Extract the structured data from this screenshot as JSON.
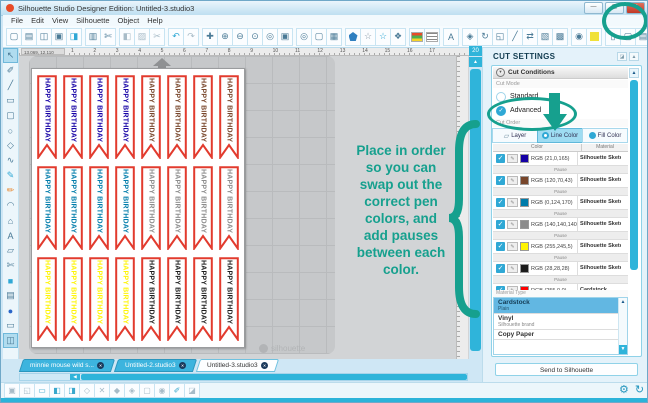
{
  "window": {
    "title": "Silhouette Studio Designer Edition: Untitled-3.studio3",
    "controls": [
      {
        "name": "minimize-button",
        "glyph": "—"
      },
      {
        "name": "maximize-button",
        "glyph": "▢"
      },
      {
        "name": "close-button",
        "glyph": "✕"
      }
    ]
  },
  "menu": [
    "File",
    "Edit",
    "View",
    "Silhouette",
    "Object",
    "Help"
  ],
  "toolbar": {
    "groups": [
      [
        {
          "n": "new-document-icon",
          "g": "▢"
        },
        {
          "n": "open-icon",
          "g": "▤"
        },
        {
          "n": "library-icon",
          "g": "◫"
        },
        {
          "n": "save-icon",
          "g": "▣"
        },
        {
          "n": "save-to-library-icon",
          "g": "◨",
          "c": "#2fa8d5"
        }
      ],
      [
        {
          "n": "print-icon",
          "g": "▥"
        },
        {
          "n": "cutter-icon",
          "g": "✄"
        }
      ],
      [
        {
          "n": "copy-icon",
          "g": "◧",
          "c": "#a8bcc8"
        },
        {
          "n": "paste-icon",
          "g": "▨",
          "c": "#a8bcc8"
        },
        {
          "n": "cut-icon",
          "g": "✂",
          "c": "#a8bcc8"
        }
      ],
      [
        {
          "n": "undo-icon",
          "g": "↶",
          "c": "#2fa8d5"
        },
        {
          "n": "redo-icon",
          "g": "↷",
          "c": "#a8bcc8"
        }
      ],
      [
        {
          "n": "pan-icon",
          "g": "✚"
        },
        {
          "n": "zoom-in-icon",
          "g": "⊕"
        },
        {
          "n": "zoom-out-icon",
          "g": "⊖"
        },
        {
          "n": "zoom-select-icon",
          "g": "⊙"
        },
        {
          "n": "drag-zoom-icon",
          "g": "◎"
        },
        {
          "n": "fit-to-window-icon",
          "g": "▣"
        }
      ],
      [
        {
          "n": "preview-icon",
          "g": "◎"
        },
        {
          "n": "page-settings-icon",
          "g": "▢"
        },
        {
          "n": "grid-settings-icon",
          "g": "▦"
        }
      ],
      [
        {
          "n": "draw-pentagon-icon",
          "shape": "pent"
        },
        {
          "n": "star-tool-icon",
          "g": "☆",
          "c": "#8a9aa8"
        },
        {
          "n": "polygon-tool-icon",
          "g": "☆",
          "c": "#2fa8d5"
        },
        {
          "n": "shape-tool-icon",
          "g": "❖"
        }
      ],
      [
        {
          "n": "fill-color-icon",
          "shape": "colorbars"
        },
        {
          "n": "line-style-icon",
          "shape": "linebars"
        }
      ],
      [
        {
          "n": "text-tool-icon",
          "g": "A"
        }
      ],
      [
        {
          "n": "move-icon",
          "g": "◈"
        },
        {
          "n": "rotate-icon",
          "g": "↻"
        },
        {
          "n": "scale-icon",
          "g": "◱"
        },
        {
          "n": "shear-icon",
          "g": "╱"
        },
        {
          "n": "mirror-icon",
          "g": "⇄"
        },
        {
          "n": "arrange-icon",
          "g": "▧"
        },
        {
          "n": "modify-icon",
          "g": "▩"
        }
      ],
      [
        {
          "n": "stamp-icon",
          "g": "◉"
        },
        {
          "n": "registration-marks-icon",
          "shape": "yellowbox"
        }
      ],
      [
        {
          "n": "pixscan-icon",
          "g": "▯"
        },
        {
          "n": "page-icon",
          "g": "▢"
        },
        {
          "n": "list-icon",
          "g": "▤"
        }
      ],
      [
        {
          "n": "cut-settings-icon",
          "g": "✏",
          "a": true,
          "c": "#1b6a96"
        },
        {
          "n": "blade-settings-icon",
          "g": "✒"
        }
      ]
    ]
  },
  "left_palette": [
    {
      "n": "select-tool",
      "g": "↖",
      "a": true
    },
    {
      "n": "point-edit-tool",
      "g": "✐"
    },
    {
      "n": "line-tool",
      "g": "╱"
    },
    {
      "n": "rectangle-tool",
      "g": "▭"
    },
    {
      "n": "rounded-rectangle-tool",
      "g": "▢"
    },
    {
      "n": "ellipse-tool",
      "g": "○"
    },
    {
      "n": "polygon-tool",
      "g": "◇"
    },
    {
      "n": "curve-tool",
      "g": "∿"
    },
    {
      "n": "freehand-tool",
      "g": "✎",
      "c": "#2fa8d5"
    },
    {
      "n": "smooth-freehand-tool",
      "g": "✏",
      "c": "#e8862a"
    },
    {
      "n": "arc-tool",
      "g": "◠"
    },
    {
      "n": "regular-polygon-tool",
      "g": "⌂"
    },
    {
      "n": "text-tool",
      "g": "A"
    },
    {
      "n": "eraser-tool",
      "g": "▱"
    },
    {
      "n": "knife-tool",
      "g": "✄"
    },
    {
      "n": "fill-tool",
      "g": "■",
      "c": "#2fa8d5"
    },
    {
      "n": "sketch-tool",
      "g": "▤"
    },
    {
      "n": "library-globe",
      "g": "●",
      "c": "#2a66c8"
    },
    {
      "n": "split-horizontal",
      "g": "▭"
    },
    {
      "n": "split-vertical",
      "g": "◫",
      "a": true
    }
  ],
  "ruler": {
    "numbers": [
      "1",
      "2",
      "3",
      "4",
      "5",
      "6",
      "7",
      "8",
      "9",
      "10",
      "11",
      "12",
      "13",
      "14",
      "15",
      "16",
      "17"
    ],
    "end_number": "20",
    "position_readout": "13.069, 12.110"
  },
  "canvas": {
    "banner_text": "HAPPY BIRTHDAY",
    "banner_outline": "#E23B2E",
    "rows": [
      {
        "left": "#1500A5",
        "right": "#78462B"
      },
      {
        "left": "#007CAA",
        "right": "#8C8C8C"
      },
      {
        "left": "#FFF505",
        "right": "#1C1C1C"
      }
    ],
    "watermark": "silhouette"
  },
  "annotation": {
    "text": "Place in order\nso you can\nswap out the\ncorrect pen\ncolors, and\nadd pauses\nbetween each\ncolor.",
    "color": "#16A08E"
  },
  "panel": {
    "title": "CUT SETTINGS",
    "cut_conditions_label": "Cut Conditions",
    "cut_mode_label": "Cut Mode",
    "cut_order_label": "Cut Order",
    "radios": [
      {
        "label": "Standard",
        "selected": false
      },
      {
        "label": "Advanced",
        "selected": true
      }
    ],
    "tabs": [
      {
        "label": "Layer",
        "icon": "layer",
        "active": false
      },
      {
        "label": "Line Color",
        "icon": "ring",
        "active": true
      },
      {
        "label": "Fill Color",
        "icon": "dot",
        "active": false
      }
    ],
    "table": {
      "headers": [
        "Color",
        "Material"
      ],
      "rows": [
        {
          "type": "color",
          "rgb": "RGB (21,0,165)",
          "hex": "#1500A5",
          "material": "Silhouette Sketch Pen",
          "checked": true
        },
        {
          "type": "pause",
          "label": "Pause"
        },
        {
          "type": "color",
          "rgb": "RGB (120,70,43)",
          "hex": "#78462B",
          "material": "Silhouette Sketch Pen",
          "checked": true
        },
        {
          "type": "pause",
          "label": "Pause"
        },
        {
          "type": "color",
          "rgb": "RGB (0,124,170)",
          "hex": "#007CAA",
          "material": "Silhouette Sketch Pen",
          "checked": true
        },
        {
          "type": "pause",
          "label": "Pause"
        },
        {
          "type": "color",
          "rgb": "RGB (140,140,140)",
          "hex": "#8C8C8C",
          "material": "Silhouette Sketch Pen",
          "checked": true
        },
        {
          "type": "pause",
          "label": "Pause"
        },
        {
          "type": "color",
          "rgb": "RGB (255,245,5)",
          "hex": "#FFF505",
          "material": "Silhouette Sketch Pen",
          "checked": true
        },
        {
          "type": "pause",
          "label": "Pause"
        },
        {
          "type": "color",
          "rgb": "RGB (28,28,28)",
          "hex": "#1C1C1C",
          "material": "Silhouette Sketch Pen",
          "checked": true
        },
        {
          "type": "pause",
          "label": "Pause"
        },
        {
          "type": "color",
          "rgb": "RGB (255,0,0)",
          "hex": "#FF0000",
          "material": "Cardstock",
          "checked": true
        }
      ]
    },
    "material_type": {
      "label": "Material Type",
      "options": [
        {
          "name": "Cardstock",
          "sub": "Plain",
          "selected": true
        },
        {
          "name": "Vinyl",
          "sub": "Silhouette brand",
          "selected": false
        },
        {
          "name": "Copy Paper",
          "sub": "",
          "selected": false
        }
      ]
    },
    "send_button": "Send to Silhouette"
  },
  "doc_tabs": [
    {
      "label": "minnie mouse wild s...",
      "active": false
    },
    {
      "label": "Untitled-2.studio3",
      "active": false
    },
    {
      "label": "Untitled-3.studio3",
      "active": true
    }
  ],
  "bottom_toolbar": [
    {
      "n": "group-icon",
      "g": "▣",
      "c": "#a8bcc8"
    },
    {
      "n": "ungroup-icon",
      "g": "◱",
      "c": "#a8bcc8"
    },
    {
      "n": "duplicate-icon",
      "g": "▭",
      "c": "#3aa8cc"
    },
    {
      "n": "mirror-copy-icon",
      "g": "◧",
      "c": "#3aa8cc"
    },
    {
      "n": "rotate-copy-icon",
      "g": "◨",
      "c": "#3aa8cc"
    },
    {
      "n": "compound-path-icon",
      "g": "◇",
      "c": "#a8bcc8"
    },
    {
      "n": "delete-icon",
      "g": "✕",
      "c": "#a8bcc8"
    },
    {
      "n": "weld-icon",
      "g": "◆",
      "c": "#a8bcc8"
    },
    {
      "n": "intersect-icon",
      "g": "◈",
      "c": "#a8bcc8"
    },
    {
      "n": "subtract-icon",
      "g": "▢",
      "c": "#a8bcc8"
    },
    {
      "n": "trace-icon",
      "g": "◉",
      "c": "#a8bcc8"
    },
    {
      "n": "eyedropper-icon",
      "g": "✐",
      "c": "#3aa8cc"
    },
    {
      "n": "offset-icon",
      "g": "◪",
      "c": "#a8bcc8"
    }
  ],
  "corner_icons": [
    {
      "n": "preferences-gear-icon",
      "g": "⚙"
    },
    {
      "n": "sync-icon",
      "g": "↻"
    }
  ]
}
